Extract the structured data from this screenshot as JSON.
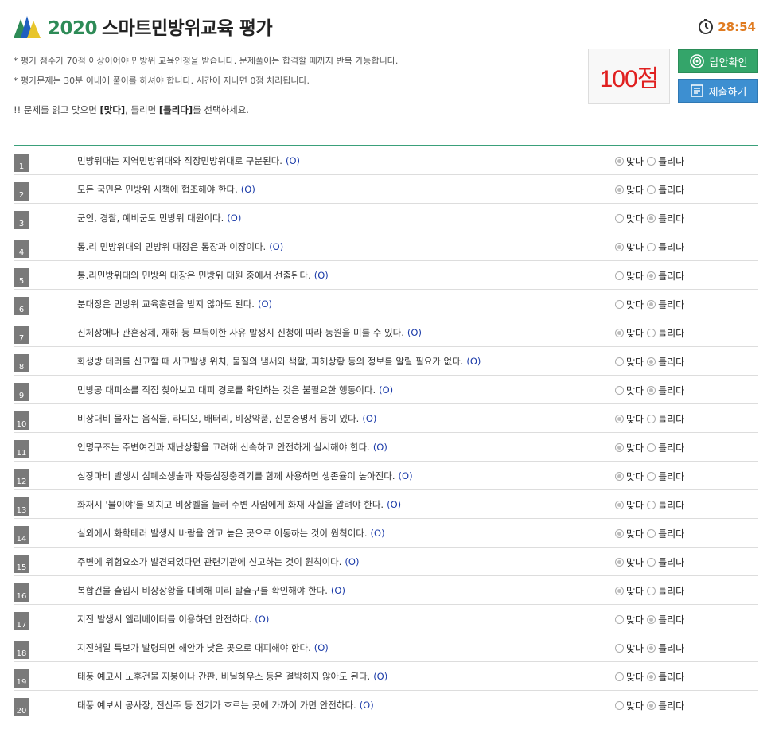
{
  "header": {
    "year": "2020",
    "title": "스마트민방위교육 평가",
    "timer": "28:54",
    "notes": [
      "* 평가 점수가 70점 이상이어야 민방위 교육인정을 받습니다. 문제풀이는 합격할 때까지 반복 가능합니다.",
      "* 평가문제는 30분 이내에 풀이를 하셔야 합니다. 시간이 지나면 0점 처리됩니다."
    ],
    "instruction_pre": "!! 문제를 읽고 맞으면 ",
    "instruction_yes": "[맞다]",
    "instruction_mid": ", 틀리면 ",
    "instruction_no": "[틀리다]",
    "instruction_post": "를 선택하세요.",
    "score": "100점",
    "answer_button": "답안확인",
    "submit_button": "제출하기"
  },
  "colors": {
    "accent_green": "#34a56a",
    "accent_blue": "#3d8fd1",
    "score_red": "#e02020",
    "timer_orange": "#e07b20"
  },
  "options": {
    "yes": "맞다",
    "no": "틀리다"
  },
  "questions": [
    {
      "num": "1",
      "text": "민방위대는 지역민방위대와 직장민방위대로 구분된다.",
      "mark": "(O)",
      "selected": "yes"
    },
    {
      "num": "2",
      "text": "모든 국민은 민방위 시책에 협조해야 한다.",
      "mark": "(O)",
      "selected": "yes"
    },
    {
      "num": "3",
      "text": "군인, 경찰, 예비군도 민방위 대원이다.",
      "mark": "(O)",
      "selected": "no"
    },
    {
      "num": "4",
      "text": "통.리 민방위대의 민방위 대장은 통장과 이장이다.",
      "mark": "(O)",
      "selected": "yes"
    },
    {
      "num": "5",
      "text": "통.리민방위대의 민방위 대장은 민방위 대원 중에서 선출된다.",
      "mark": "(O)",
      "selected": "no"
    },
    {
      "num": "6",
      "text": "분대장은 민방위 교육훈련을 받지 않아도 된다.",
      "mark": "(O)",
      "selected": "no"
    },
    {
      "num": "7",
      "text": "신체장애나 관혼상제, 재해 등 부득이한 사유 발생시 신청에 따라 동원을 미룰 수 있다.",
      "mark": "(O)",
      "selected": "yes"
    },
    {
      "num": "8",
      "text": "화생방 테러를 신고할 때 사고발생 위치, 물질의 냄새와 색깔, 피해상황 등의 정보를 알릴 필요가 없다.",
      "mark": "(O)",
      "selected": "no"
    },
    {
      "num": "9",
      "text": "민방공 대피소를 직접 찾아보고 대피 경로를 확인하는 것은 불필요한 행동이다.",
      "mark": "(O)",
      "selected": "no"
    },
    {
      "num": "10",
      "text": "비상대비 물자는 음식물, 라디오, 배터리, 비상약품, 신분증명서 등이 있다.",
      "mark": "(O)",
      "selected": "yes"
    },
    {
      "num": "11",
      "text": "인명구조는 주변여건과 재난상황을 고려해 신속하고 안전하게 실시해야 한다.",
      "mark": "(O)",
      "selected": "yes"
    },
    {
      "num": "12",
      "text": "심장마비 발생시 심폐소생술과 자동심장충격기를 함께 사용하면 생존율이 높아진다.",
      "mark": "(O)",
      "selected": "yes"
    },
    {
      "num": "13",
      "text": "화재시 '불이야'를 외치고 비상벨을 눌러 주변 사람에게 화재 사실을 알려야 한다.",
      "mark": "(O)",
      "selected": "yes"
    },
    {
      "num": "14",
      "text": "실외에서 화학테러 발생시 바람을 안고 높은 곳으로 이동하는 것이 원칙이다.",
      "mark": "(O)",
      "selected": "yes"
    },
    {
      "num": "15",
      "text": "주변에 위험요소가 발견되었다면 관련기관에 신고하는 것이 원칙이다.",
      "mark": "(O)",
      "selected": "yes"
    },
    {
      "num": "16",
      "text": "복합건물 출입시 비상상황을 대비해 미리 탈출구를 확인해야 한다.",
      "mark": "(O)",
      "selected": "yes"
    },
    {
      "num": "17",
      "text": "지진 발생시 엘리베이터를 이용하면 안전하다.",
      "mark": "(O)",
      "selected": "no"
    },
    {
      "num": "18",
      "text": "지진해일 특보가 발령되면 해안가 낮은 곳으로 대피해야 한다.",
      "mark": "(O)",
      "selected": "no"
    },
    {
      "num": "19",
      "text": "태풍 예고시 노후건물 지붕이나 간판, 비닐하우스 등은 결박하지 않아도 된다.",
      "mark": "(O)",
      "selected": "no"
    },
    {
      "num": "20",
      "text": "태풍 예보시 공사장, 전신주 등 전기가 흐르는 곳에 가까이 가면 안전하다.",
      "mark": "(O)",
      "selected": "no"
    }
  ]
}
